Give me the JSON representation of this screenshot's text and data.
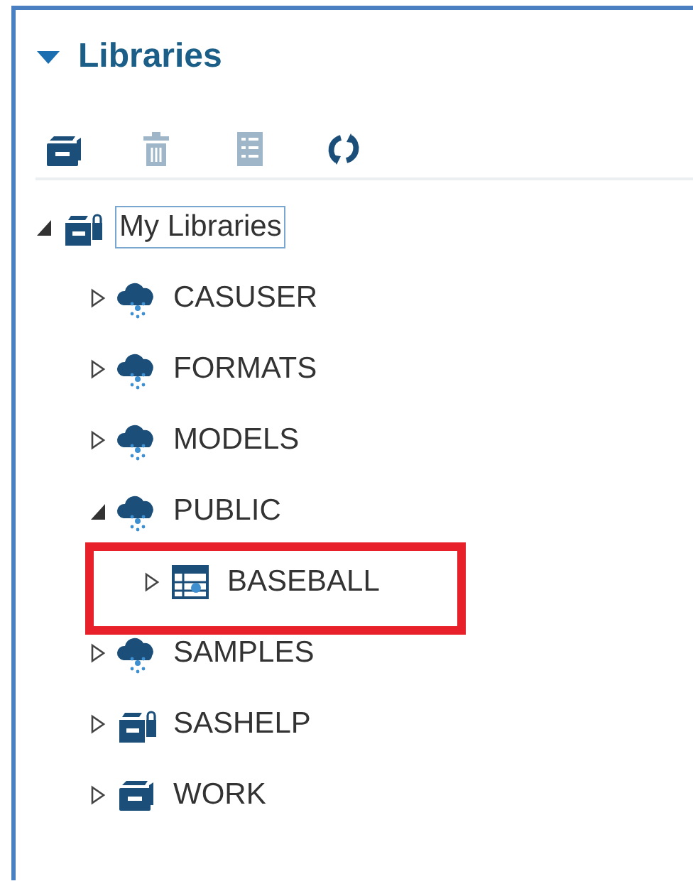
{
  "panel": {
    "title": "Libraries",
    "expanded": true
  },
  "toolbar": [
    {
      "kind": "new-library",
      "disabled": false
    },
    {
      "kind": "delete",
      "disabled": true
    },
    {
      "kind": "properties",
      "disabled": true
    },
    {
      "kind": "refresh",
      "disabled": false
    }
  ],
  "tree": [
    {
      "label": "My Libraries",
      "kind": "library-locked",
      "expanded": true,
      "selected": true,
      "highlighted": false,
      "children": [
        {
          "label": "CASUSER",
          "kind": "cas-library",
          "expanded": false,
          "selected": false,
          "highlighted": false
        },
        {
          "label": "FORMATS",
          "kind": "cas-library",
          "expanded": false,
          "selected": false,
          "highlighted": false
        },
        {
          "label": "MODELS",
          "kind": "cas-library",
          "expanded": false,
          "selected": false,
          "highlighted": false
        },
        {
          "label": "PUBLIC",
          "kind": "cas-library",
          "expanded": true,
          "selected": false,
          "highlighted": false,
          "children": [
            {
              "label": "BASEBALL",
              "kind": "table",
              "expanded": false,
              "selected": false,
              "highlighted": true
            }
          ]
        },
        {
          "label": "SAMPLES",
          "kind": "cas-library",
          "expanded": false,
          "selected": false,
          "highlighted": false
        },
        {
          "label": "SASHELP",
          "kind": "library-locked",
          "expanded": false,
          "selected": false,
          "highlighted": false
        },
        {
          "label": "WORK",
          "kind": "library",
          "expanded": false,
          "selected": false,
          "highlighted": false
        }
      ]
    }
  ]
}
